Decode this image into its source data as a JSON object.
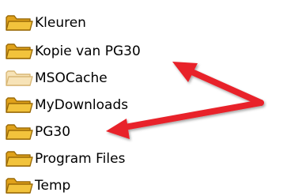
{
  "folders": [
    {
      "label": "Kleuren",
      "icon": "folder-icon",
      "dimmed": false
    },
    {
      "label": "Kopie van PG30",
      "icon": "folder-icon",
      "dimmed": false
    },
    {
      "label": "MSOCache",
      "icon": "folder-icon",
      "dimmed": true
    },
    {
      "label": "MyDownloads",
      "icon": "folder-icon",
      "dimmed": false
    },
    {
      "label": "PG30",
      "icon": "folder-icon",
      "dimmed": false
    },
    {
      "label": "Program Files",
      "icon": "folder-icon",
      "dimmed": false
    },
    {
      "label": "Temp",
      "icon": "folder-icon",
      "dimmed": false
    }
  ],
  "colors": {
    "folder_fill": "#f2c33c",
    "folder_tab": "#e0a21a",
    "folder_outline": "#9a6a08",
    "folder_dim_fill": "#f7e3b7",
    "folder_dim_outline": "#d9b877",
    "arrow": "#e8242a"
  }
}
